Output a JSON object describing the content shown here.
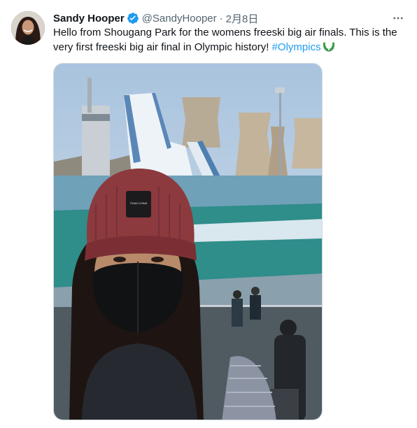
{
  "tweet": {
    "author_name": "Sandy Hooper",
    "handle": "@SandyHooper",
    "separator": "·",
    "date": "2月8日",
    "text": "Hello from Shougang Park for the womens freeski big air finals. This is the very first freeski big air final in Olympic history! ",
    "hashtag": "#Olympics",
    "hat_patch_text": "TEAM CHINA"
  },
  "icons": {
    "verified": "verified-badge-icon",
    "more": "more-options-icon",
    "laurel": "olympic-laurel-icon"
  },
  "colors": {
    "link": "#1d9bf0",
    "secondary_text": "#536471",
    "verified": "#1d9bf0"
  }
}
